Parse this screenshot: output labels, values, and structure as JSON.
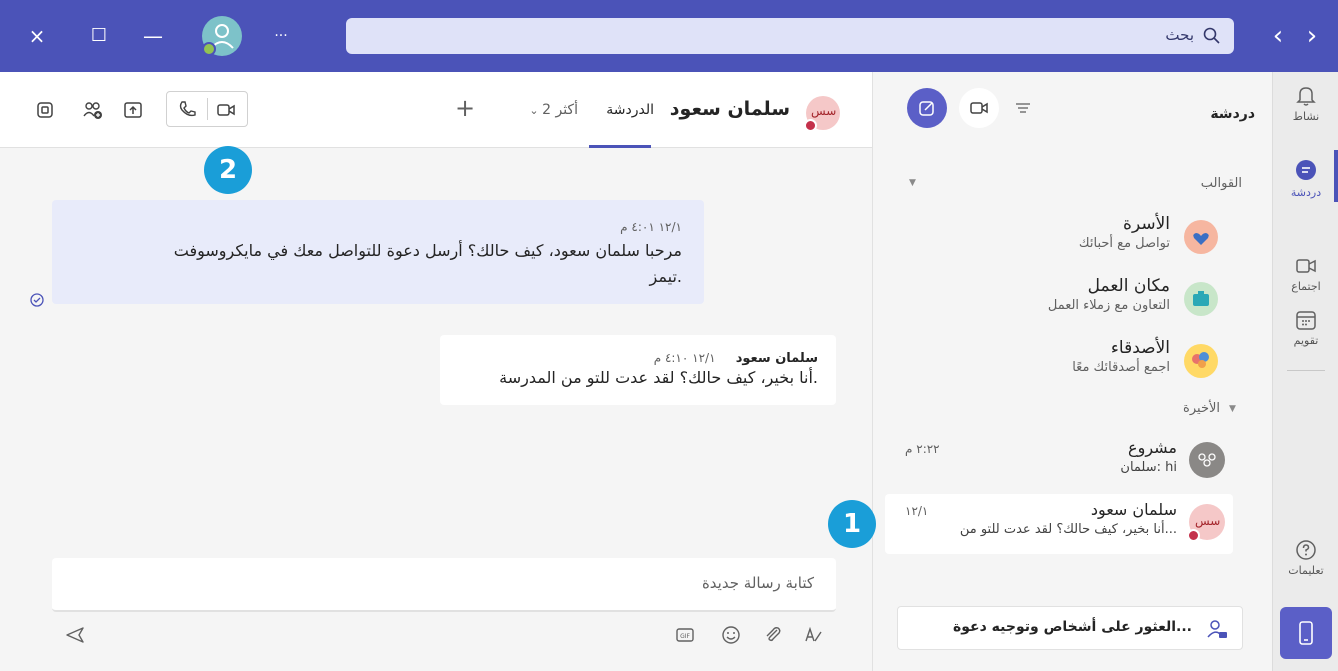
{
  "titlebar": {
    "search_placeholder": "بحث",
    "more_label": "···",
    "controls": {
      "close": "×",
      "maximize": "☐",
      "minimize": "—"
    },
    "nav_back": "‹",
    "nav_forward": "›"
  },
  "rail": {
    "items": [
      {
        "label": "نشاط",
        "icon": "bell-icon"
      },
      {
        "label": "دردشة",
        "icon": "chat-icon",
        "active": true
      },
      {
        "label": "اجتماع",
        "icon": "video-icon"
      },
      {
        "label": "تقويم",
        "icon": "calendar-icon"
      },
      {
        "label": "تعليمات",
        "icon": "help-icon"
      }
    ]
  },
  "chatlist": {
    "title": "دردشة",
    "templates_label": "القوالب",
    "recent_label": "الأخيرة",
    "templates": [
      {
        "name": "الأسرة",
        "desc": "تواصل مع أحبائك",
        "color": "#f6b6a0"
      },
      {
        "name": "مكان العمل",
        "desc": "التعاون مع زملاء العمل",
        "color": "#c8e6c9"
      },
      {
        "name": "الأصدقاء",
        "desc": "اجمع أصدقائك معًا",
        "color": "#ffd966"
      }
    ],
    "recent": [
      {
        "name": "مشروع",
        "preview": "سلمان: hi",
        "time": "٢:٢٢ م"
      },
      {
        "name": "سلمان سعود",
        "preview": "أنا بخير، كيف حالك؟ لقد عدت للتو من...",
        "time": "١٢/١",
        "avatar_text": "سس"
      }
    ],
    "invite_label": "العثور على أشخاص وتوجيه دعوة..."
  },
  "main": {
    "contact_name": "سلمان سعود",
    "avatar_text": "سس",
    "tab_chat": "الدردشة",
    "tab_more": "2 أكثر",
    "add_tab": "+",
    "messages": [
      {
        "type": "out",
        "time": "١٢/١ ٤:٠١ م",
        "text_line1": "مرحبا سلمان سعود، كيف حالك؟ أرسل دعوة للتواصل معك في مايكروسوفت",
        "text_line2": "تيمز."
      },
      {
        "type": "in",
        "sender": "سلمان سعود",
        "time": "١٢/١ ٤:١٠ م",
        "text": "أنا بخير، كيف حالك؟ لقد عدت للتو من المدرسة."
      }
    ],
    "compose_placeholder": "كتابة رسالة جديدة"
  },
  "badges": {
    "one": "1",
    "two": "2"
  },
  "colors": {
    "brand": "#4b53b8",
    "badge": "#1a9ed8",
    "presence_busy": "#c4314b"
  }
}
